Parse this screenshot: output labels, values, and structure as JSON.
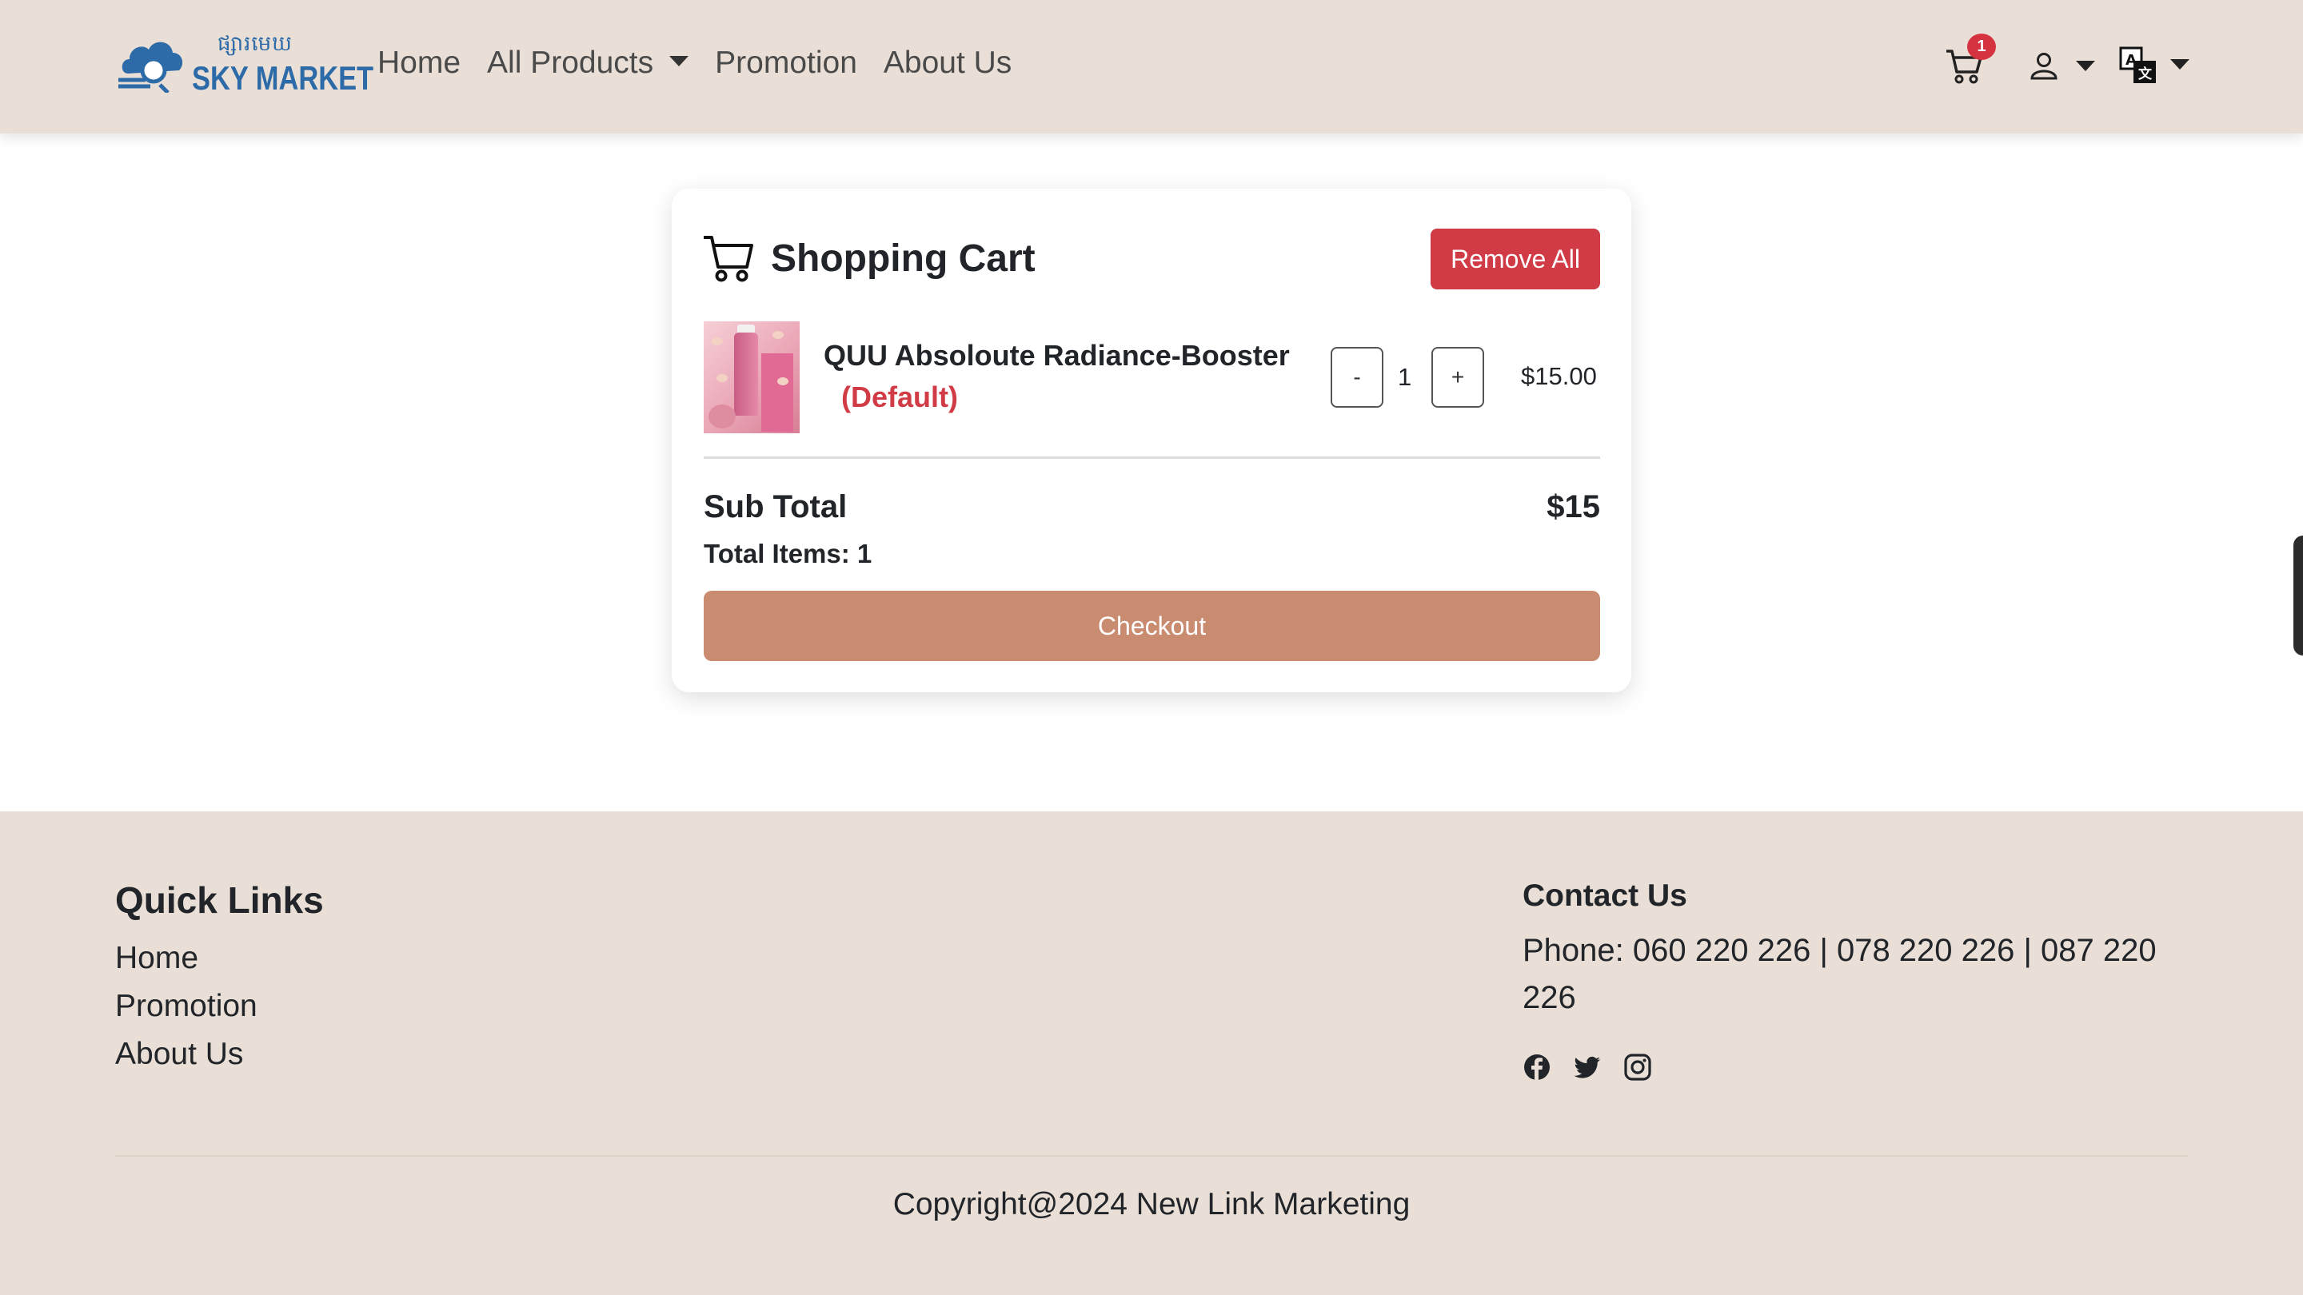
{
  "header": {
    "logo_khmer": "ផ្សារមេឃ",
    "logo_text": "SKY MARKET",
    "nav": [
      {
        "label": "Home"
      },
      {
        "label": "All Products"
      },
      {
        "label": "Promotion"
      },
      {
        "label": "About Us"
      }
    ],
    "cart_count": "1",
    "icons": {
      "cart": "cart-icon",
      "user": "user-icon",
      "language": "translate-icon"
    }
  },
  "cart": {
    "title": "Shopping Cart",
    "remove_all_label": "Remove All",
    "items": [
      {
        "name": "QUU Absoloute Radiance-Booster",
        "variant": "(Default)",
        "quantity": "1",
        "minus_label": "-",
        "plus_label": "+",
        "price": "$15.00"
      }
    ],
    "subtotal_label": "Sub Total",
    "subtotal_value": "$15",
    "total_items": "Total Items: 1",
    "checkout_label": "Checkout"
  },
  "footer": {
    "quick_links_title": "Quick Links",
    "quick_links": [
      "Home",
      "Promotion",
      "About Us"
    ],
    "contact_title": "Contact Us",
    "phone": "Phone: 060 220 226 | 078 220 226 | 087 220 226",
    "social": [
      "facebook-icon",
      "twitter-icon",
      "instagram-icon"
    ],
    "copyright": "Copyright@2024 New Link Marketing"
  },
  "colors": {
    "header_bg": "#e9dfd6",
    "brand_blue": "#2d6aa8",
    "danger": "#d13b45",
    "checkout": "#c98c70"
  }
}
